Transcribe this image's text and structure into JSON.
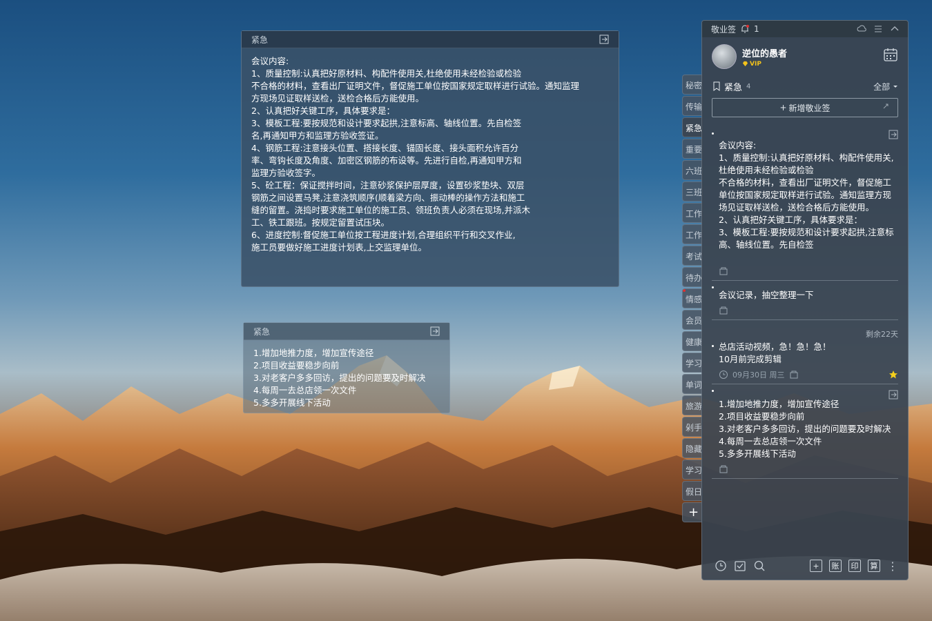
{
  "note_large": {
    "title": "紧急",
    "body": "会议内容:\n1、质量控制:认真把好原材料、构配件使用关,杜绝使用未经检验或检验\n不合格的材料，查看出厂证明文件，督促施工单位按国家规定取样进行试验。通知监理\n方现场见证取样送检，送检合格后方能使用。\n2、认真把好关键工序，具体要求是：\n3、模板工程:要按规范和设计要求起拱,注意标高、轴线位置。先自检签\n名,再通知甲方和监理方验收签证。\n4、钢筋工程:注意接头位置、搭接长度、锚固长度、接头面积允许百分\n率、弯钩长度及角度、加密区钢筋的布设等。先进行自检,再通知甲方和\n监理方验收签字。\n5、砼工程：保证搅拌时间，注意砂浆保护层厚度，设置砂浆垫块、双层\n钢筋之间设置马凳,注意浇筑顺序(顺着梁方向、振动棒的操作方法和施工\n缝的留置。浇捣时要求施工单位的施工员、领班负责人必须在现场,并派木\n工、铁工跟班。按规定留置试压块。\n6、进度控制:督促施工单位按工程进度计划,合理组织平行和交叉作业,\n施工员要做好施工进度计划表,上交监理单位。"
  },
  "note_small": {
    "title": "紧急",
    "body": "1.增加地推力度，增加宣传途径\n2.项目收益要稳步向前\n3.对老客户多多回访，提出的问题要及时解决\n4.每周一去总店领一次文件\n5.多多开展线下活动"
  },
  "tabs": [
    "秘密",
    "传输",
    "紧急",
    "重要",
    "六班",
    "三班",
    "工作",
    "工作",
    "考试",
    "待办",
    "情感",
    "会员",
    "健康",
    "学习",
    "单词",
    "旅游",
    "剁手",
    "隐藏",
    "学习",
    "假日"
  ],
  "tabs_active_index": 2,
  "tabs_add": "+",
  "panel": {
    "app_title": "敬业签",
    "notif_count": "1",
    "username": "逆位的愚者",
    "vip_label": "VIP",
    "category": "紧急",
    "category_count": "4",
    "filter": "全部",
    "add_button": "新增敬业签",
    "items": [
      {
        "text": "会议内容:\n1、质量控制:认真把好原材料、构配件使用关,杜绝使用未经检验或检验\n不合格的材料，查看出厂证明文件，督促施工单位按国家规定取样进行试验。通知监理方现场见证取样送检，送检合格后方能使用。\n2、认真把好关键工序，具体要求是：\n3、模板工程:要按规范和设计要求起拱,注意标高、轴线位置。先自检签"
      },
      {
        "text": "会议记录，抽空整理一下"
      },
      {
        "remaining": "剩余22天",
        "text": "总店活动视频，急！急！急！\n10月前完成剪辑",
        "date": "09月30日 周三"
      },
      {
        "text": "1.增加地推力度，增加宣传途径\n2.项目收益要稳步向前\n3.对老客户多多回访，提出的问题要及时解决\n4.每周一去总店领一次文件\n5.多多开展线下活动"
      }
    ],
    "bottom_buttons": [
      "+",
      "账",
      "印",
      "算"
    ]
  },
  "colors": {
    "panel_bg": "#3a4450",
    "note_bg": "#3a5066",
    "vip": "#f2c21b",
    "star": "#f5d01c",
    "alert": "#e03030"
  }
}
